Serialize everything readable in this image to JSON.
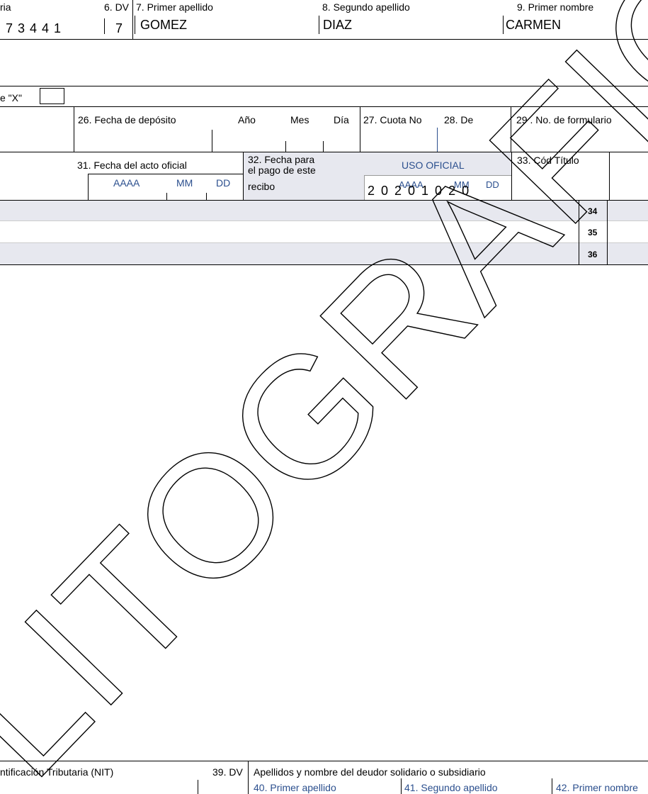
{
  "header": {
    "label_ria": "ria",
    "label_dv": "6. DV",
    "nit_digits": "7  3  4  4  1",
    "dv_value": "7",
    "label_primer_apellido": "7. Primer apellido",
    "label_segundo_apellido": "8. Segundo apellido",
    "label_primer_nombre": "9. Primer nombre",
    "primer_apellido": "GOMEZ",
    "segundo_apellido": "DIAZ",
    "primer_nombre": "CARMEN"
  },
  "marker": {
    "label": "e \"X\""
  },
  "deposit": {
    "label_fecha": "26. Fecha de depósito",
    "label_anio": "Año",
    "label_mes": "Mes",
    "label_dia": "Día",
    "label_cuota": "27. Cuota No",
    "label_de": "28. De",
    "label_formulario": "29 . No. de formulario"
  },
  "acto": {
    "label_fecha_acto": "31. Fecha del acto oficial",
    "aaaa": "AAAA",
    "mm": "MM",
    "dd": "DD",
    "label_fecha_pago_1": "32. Fecha para",
    "label_fecha_pago_2": "el pago de este",
    "label_fecha_pago_3": "recibo",
    "uso_oficial": "USO OFICIAL",
    "uso_aaaa": "AAAA",
    "uso_mm": "MM",
    "uso_dd": "DD",
    "fecha_pago_value": "2 0 2 0 1 0 2 0",
    "label_cod_titulo": "33. Cód Título"
  },
  "rows": {
    "r34": "34",
    "r35": "35",
    "r36": "36"
  },
  "footer": {
    "label_nit": "ntificación Tributaria (NIT)",
    "label_dv": "39. DV",
    "label_deudor": "Apellidos y nombre del deudor solidario o subsidiario",
    "label_primer_apellido": "40. Primer apellido",
    "label_segundo_apellido": "41. Segundo apellido",
    "label_primer_nombre": "42. Primer nombre"
  },
  "watermark": {
    "text": "LITOGRAFICO",
    "color": "#ffff00"
  }
}
